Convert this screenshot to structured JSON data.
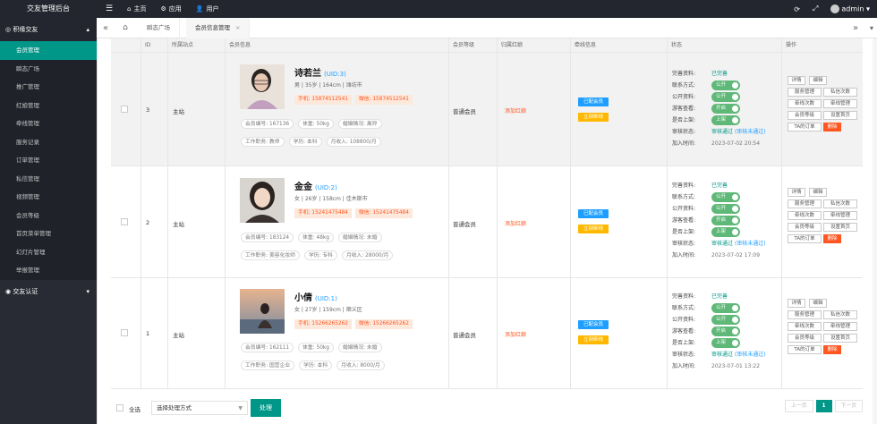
{
  "app": {
    "title": "交友管理后台"
  },
  "topnav": [
    {
      "label": "",
      "icon": "menu-icon"
    },
    {
      "label": "主页",
      "icon": "home-icon"
    },
    {
      "label": "应用",
      "icon": "gear-icon"
    },
    {
      "label": "用户",
      "icon": "user-icon"
    }
  ],
  "topright": {
    "user": "admin"
  },
  "sidebar": {
    "group": "积缘交友",
    "items": [
      "会员管理",
      "瞬态广场",
      "推广管理",
      "红娘管理",
      "牵线管理",
      "服务记录",
      "订单管理",
      "私信管理",
      "视频管理",
      "会员等级",
      "首页菜单管理",
      "幻灯片管理",
      "举报管理"
    ],
    "active_index": 0,
    "group2": "交友认证"
  },
  "tabs": [
    {
      "label": "瞬态广场"
    },
    {
      "label": "会员信息管理",
      "close": "×"
    }
  ],
  "table": {
    "headers": [
      "ID",
      "所属站点",
      "会员信息",
      "会员等级",
      "归属红娘",
      "牵线信息",
      "状态",
      "操作"
    ],
    "rows": [
      {
        "id": "3",
        "site": "主站",
        "name": "诗若兰",
        "uid": "(UID:3)",
        "basic": "男 | 35岁 | 164cm | 潍坊市",
        "phone": "手机: 15874512541",
        "wechat": "微信: 15874512541",
        "attr1": "会员编号: 167136",
        "attr2": "体重: 50kg",
        "attr3": "婚姻情况: 离异",
        "attr4": "工作职务: 教师",
        "attr5": "学历: 本科",
        "attr6": "月收入: 108800/月",
        "level": "普通会员",
        "matchmaker": "添加红娘",
        "tag1": "已配会员",
        "tag2": "立刻牵线",
        "status": {
          "complete_label": "完善资料:",
          "complete_val": "已完善",
          "contact_label": "联系方式:",
          "contact_sw": "公开",
          "public_label": "公开资料:",
          "public_sw": "公开",
          "guest_label": "游客查看:",
          "guest_sw": "开启",
          "top_label": "是否上架:",
          "top_sw": "上架",
          "audit_label": "审核状态:",
          "audit_val": "审核通过",
          "audit_extra": "(审核未通过)",
          "join_label": "加入时间:",
          "join_val": "2023-07-02 20:54"
        },
        "ops": [
          "详情",
          "编辑",
          "服务管理",
          "私信次数",
          "牵线次数",
          "牵线管理",
          "会员等级",
          "设置首页",
          "TA的订单",
          "删除"
        ]
      },
      {
        "id": "2",
        "site": "主站",
        "name": "金金",
        "uid": "(UID:2)",
        "basic": "女 | 26岁 | 158cm | 佳木斯市",
        "phone": "手机: 15241475484",
        "wechat": "微信: 15241475484",
        "attr1": "会员编号: 183124",
        "attr2": "体重: 48kg",
        "attr3": "婚姻情况: 未婚",
        "attr4": "工作职务: 美容化妆师",
        "attr5": "学历: 专科",
        "attr6": "月收入: 28000/月",
        "level": "普通会员",
        "matchmaker": "添加红娘",
        "tag1": "已配会员",
        "tag2": "立刻牵线",
        "status": {
          "complete_label": "完善资料:",
          "complete_val": "已完善",
          "contact_label": "联系方式:",
          "contact_sw": "公开",
          "public_label": "公开资料:",
          "public_sw": "公开",
          "guest_label": "游客查看:",
          "guest_sw": "开启",
          "top_label": "是否上架:",
          "top_sw": "上架",
          "audit_label": "审核状态:",
          "audit_val": "审核通过",
          "audit_extra": "(审核未通过)",
          "join_label": "加入时间:",
          "join_val": "2023-07-02 17:09"
        },
        "ops": [
          "详情",
          "编辑",
          "服务管理",
          "私信次数",
          "牵线次数",
          "牵线管理",
          "会员等级",
          "设置首页",
          "TA的订单",
          "删除"
        ]
      },
      {
        "id": "1",
        "site": "主站",
        "name": "小倩",
        "uid": "(UID:1)",
        "basic": "女 | 27岁 | 159cm | 顺义区",
        "phone": "手机: 15266265262",
        "wechat": "微信: 15266265262",
        "attr1": "会员编号: 162111",
        "attr2": "体重: 50kg",
        "attr3": "婚姻情况: 未婚",
        "attr4": "工作职务: 国营企业",
        "attr5": "学历: 本科",
        "attr6": "月收入: 8000/月",
        "level": "普通会员",
        "matchmaker": "添加红娘",
        "tag1": "已配会员",
        "tag2": "立刻牵线",
        "status": {
          "complete_label": "完善资料:",
          "complete_val": "已完善",
          "contact_label": "联系方式:",
          "contact_sw": "公开",
          "public_label": "公开资料:",
          "public_sw": "公开",
          "guest_label": "游客查看:",
          "guest_sw": "开启",
          "top_label": "是否上架:",
          "top_sw": "上架",
          "audit_label": "审核状态:",
          "audit_val": "审核通过",
          "audit_extra": "(审核未通过)",
          "join_label": "加入时间:",
          "join_val": "2023-07-01 13:22"
        },
        "ops": [
          "详情",
          "编辑",
          "服务管理",
          "私信次数",
          "牵线次数",
          "牵线管理",
          "会员等级",
          "设置首页",
          "TA的订单",
          "删除"
        ]
      }
    ]
  },
  "bottom": {
    "select_all": "全选",
    "select_placeholder": "选择处理方式",
    "process": "处理",
    "pager": {
      "prev": "上一页",
      "current": "1",
      "next": "下一页"
    }
  },
  "colors": {
    "primary": "#009688",
    "accent": "#ff5722",
    "link": "#1e9fff",
    "warn": "#ffb800",
    "sidebar": "#282b33"
  }
}
